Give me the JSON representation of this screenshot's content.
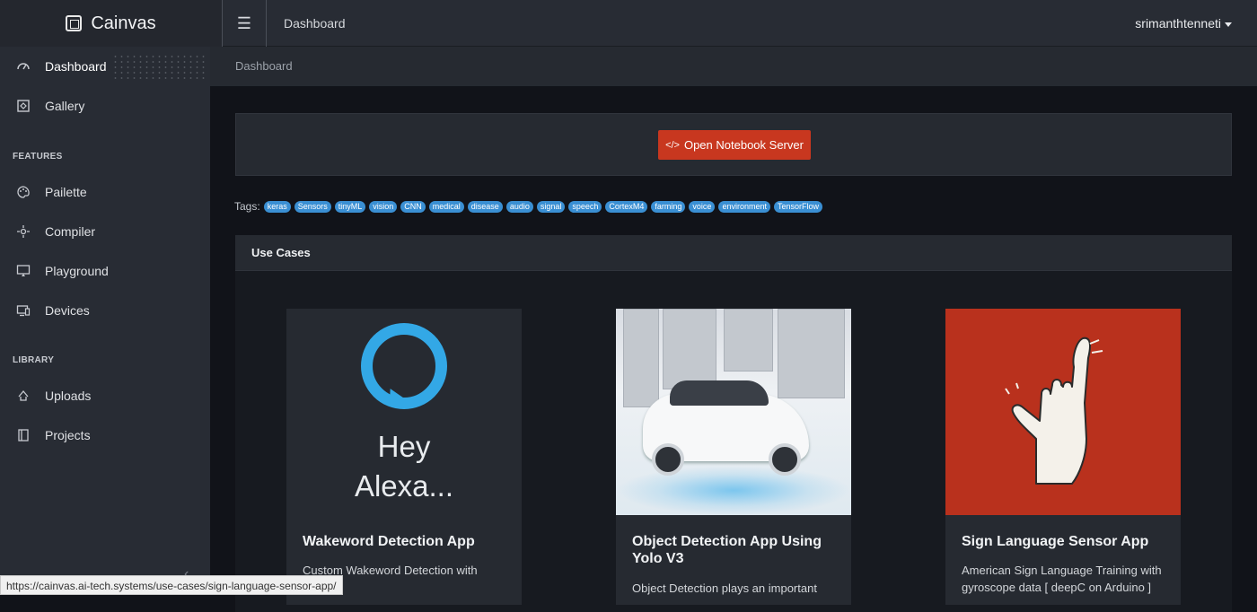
{
  "brand": {
    "name": "Cainvas"
  },
  "header": {
    "title": "Dashboard",
    "user": "srimanthtenneti"
  },
  "sidebar": {
    "items": [
      {
        "label": "Dashboard"
      },
      {
        "label": "Gallery"
      },
      {
        "label": "Pailette"
      },
      {
        "label": "Compiler"
      },
      {
        "label": "Playground"
      },
      {
        "label": "Devices"
      },
      {
        "label": "Uploads"
      },
      {
        "label": "Projects"
      }
    ],
    "sections": {
      "features": "FEATURES",
      "library": "LIBRARY"
    }
  },
  "breadcrumb": "Dashboard",
  "notebook_button": "Open Notebook Server",
  "tags_label": "Tags:",
  "tags": [
    "keras",
    "Sensors",
    "tinyML",
    "vision",
    "CNN",
    "medical",
    "disease",
    "audio",
    "signal",
    "speech",
    "CortexM4",
    "farming",
    "voice",
    "environment",
    "TensorFlow"
  ],
  "usecases": {
    "title": "Use Cases",
    "cards": [
      {
        "title": "Wakeword Detection App",
        "desc": "Custom Wakeword Detection with deepC",
        "image_text": "Hey Alexa..."
      },
      {
        "title": "Object Detection App Using Yolo V3",
        "desc": "Object Detection plays an important"
      },
      {
        "title": "Sign Language Sensor App",
        "desc": "American Sign Language Training with gyroscope data [ deepC on Arduino ]"
      }
    ]
  },
  "status_url": "https://cainvas.ai-tech.systems/use-cases/sign-language-sensor-app/",
  "colors": {
    "accent": "#c8371f",
    "tag": "#3a8fd3",
    "alexa_ring": "#33a8e6",
    "hand_bg": "#b9311d"
  }
}
